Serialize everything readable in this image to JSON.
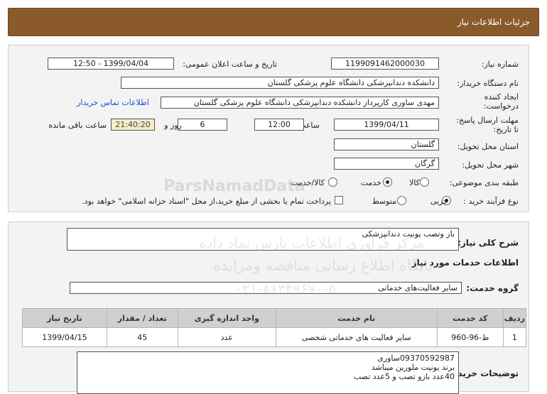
{
  "header": {
    "title": "جزئیات اطلاعات نیاز"
  },
  "form": {
    "need_number_label": "شماره نیاز:",
    "need_number": "1199091462000030",
    "announce_label": "تاریخ و ساعت اعلان عمومی:",
    "announce_value": "1399/04/04 - 12:50",
    "buyer_org_label": "نام دستگاه خریدار:",
    "buyer_org": "دانشکده دندانپزشکی دانشگاه علوم پزشکی گلستان",
    "creator_label_1": "ایجاد کننده",
    "creator_label_2": "درخواست:",
    "creator": "مهدی ساوری کارپرداز دانشکده دندانپزشکی دانشگاه علوم پزشکی گلستان",
    "contact_link": "اطلاعات تماس خریدار",
    "deadline_label_1": "مهلت ارسال پاسخ:",
    "deadline_label_2": "تا تاریخ:",
    "deadline_date": "1399/04/11",
    "time_label": "ساعت",
    "deadline_time": "12:00",
    "days_value": "6",
    "days_label": "روز و",
    "remaining_time": "21:40:20",
    "remaining_label": "ساعت باقی مانده",
    "province_label": "استان محل تحویل:",
    "province": "گلستان",
    "city_label": "شهر محل تحویل:",
    "city": "گرگان",
    "category_label": "طبقه بندی موضوعی:",
    "category_options": [
      "کالا",
      "خدمت",
      "کالا/خدمت"
    ],
    "category_selected": "خدمت",
    "process_label": "نوع فرآیند خرید :",
    "process_options": [
      "جزیی",
      "متوسط"
    ],
    "process_selected": "جزیی",
    "payment_note": "پرداخت تمام یا بخشی از مبلغ خرید،از محل \"اسناد خزانه اسلامی\" خواهد بود."
  },
  "details": {
    "summary_label": "شرح کلی نیاز:",
    "summary": "باز وتصب یونیت دندانپزشکی",
    "services_heading": "اطلاعات خدمات مورد نیاز",
    "service_group_label": "گروه خدمت:",
    "service_group": "سایر فعالیت‌های خدماتی",
    "table_headers": [
      "ردیف",
      "کد خدمت",
      "نام خدمت",
      "واحد اندازه گیری",
      "تعداد / مقدار",
      "تاریخ نیاز"
    ],
    "table_rows": [
      [
        "1",
        "ط-96-960",
        "سایر فعالیت های خدماتی شخصی",
        "عدد",
        "45",
        "1399/04/15"
      ]
    ],
    "buyer_notes_label": "توضیحات خریدار:",
    "buyer_notes": [
      "09370592987ساوری",
      "برند یونیت ملورین میباشد",
      "40عدد بازو تصب و 5عدد تصب"
    ]
  },
  "watermark": {
    "line1": "ParsNamadData",
    "line2": "مرکز فراوری اطلاعات پارس نماد داده",
    "line3": "پایگاه اطلاع رسانی مناقصه ومزایده",
    "line4": "۰۲۱-۸۸۳۴۹۶۷۰-۵"
  }
}
